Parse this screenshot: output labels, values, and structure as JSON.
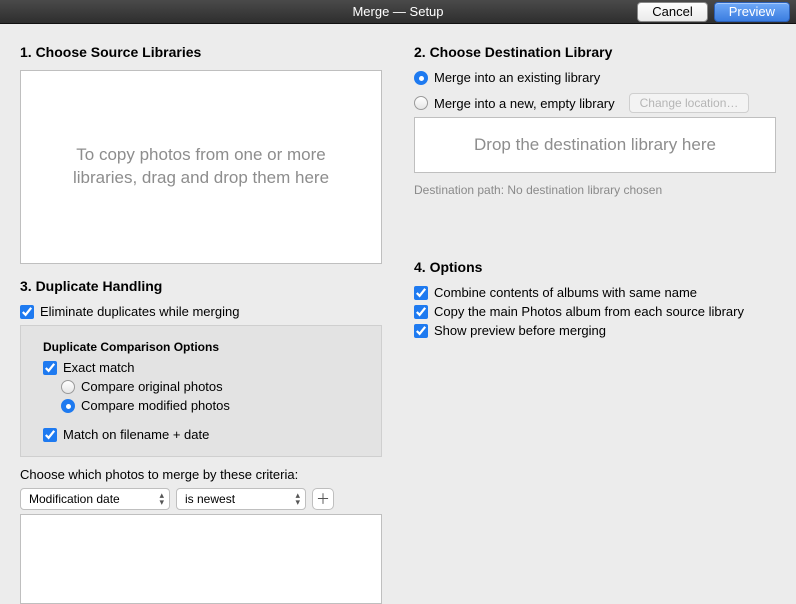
{
  "titlebar": {
    "title": "Merge — Setup",
    "cancel": "Cancel",
    "preview": "Preview"
  },
  "section1": {
    "header": "1. Choose Source Libraries",
    "dropzone": "To copy photos from one or more libraries, drag and drop them here"
  },
  "section2": {
    "header": "2. Choose Destination Library",
    "mergeExisting": "Merge into an existing library",
    "mergeNew": "Merge into a new, empty library",
    "changeLocation": "Change location…",
    "dropzone": "Drop the destination library here",
    "destPath": "Destination path: No destination library chosen"
  },
  "section3": {
    "header": "3. Duplicate Handling",
    "eliminate": "Eliminate duplicates while merging",
    "compareHeader": "Duplicate Comparison Options",
    "exactMatch": "Exact match",
    "compareOriginal": "Compare original photos",
    "compareModified": "Compare modified photos",
    "matchFilename": "Match on filename + date",
    "criteriaLabel": "Choose which photos to merge by these criteria:",
    "criteriaField": "Modification date",
    "criteriaOp": "is newest"
  },
  "section4": {
    "header": "4. Options",
    "combine": "Combine contents of albums with same name",
    "copyMain": "Copy the main Photos album from each source library",
    "showPreview": "Show preview before merging"
  }
}
